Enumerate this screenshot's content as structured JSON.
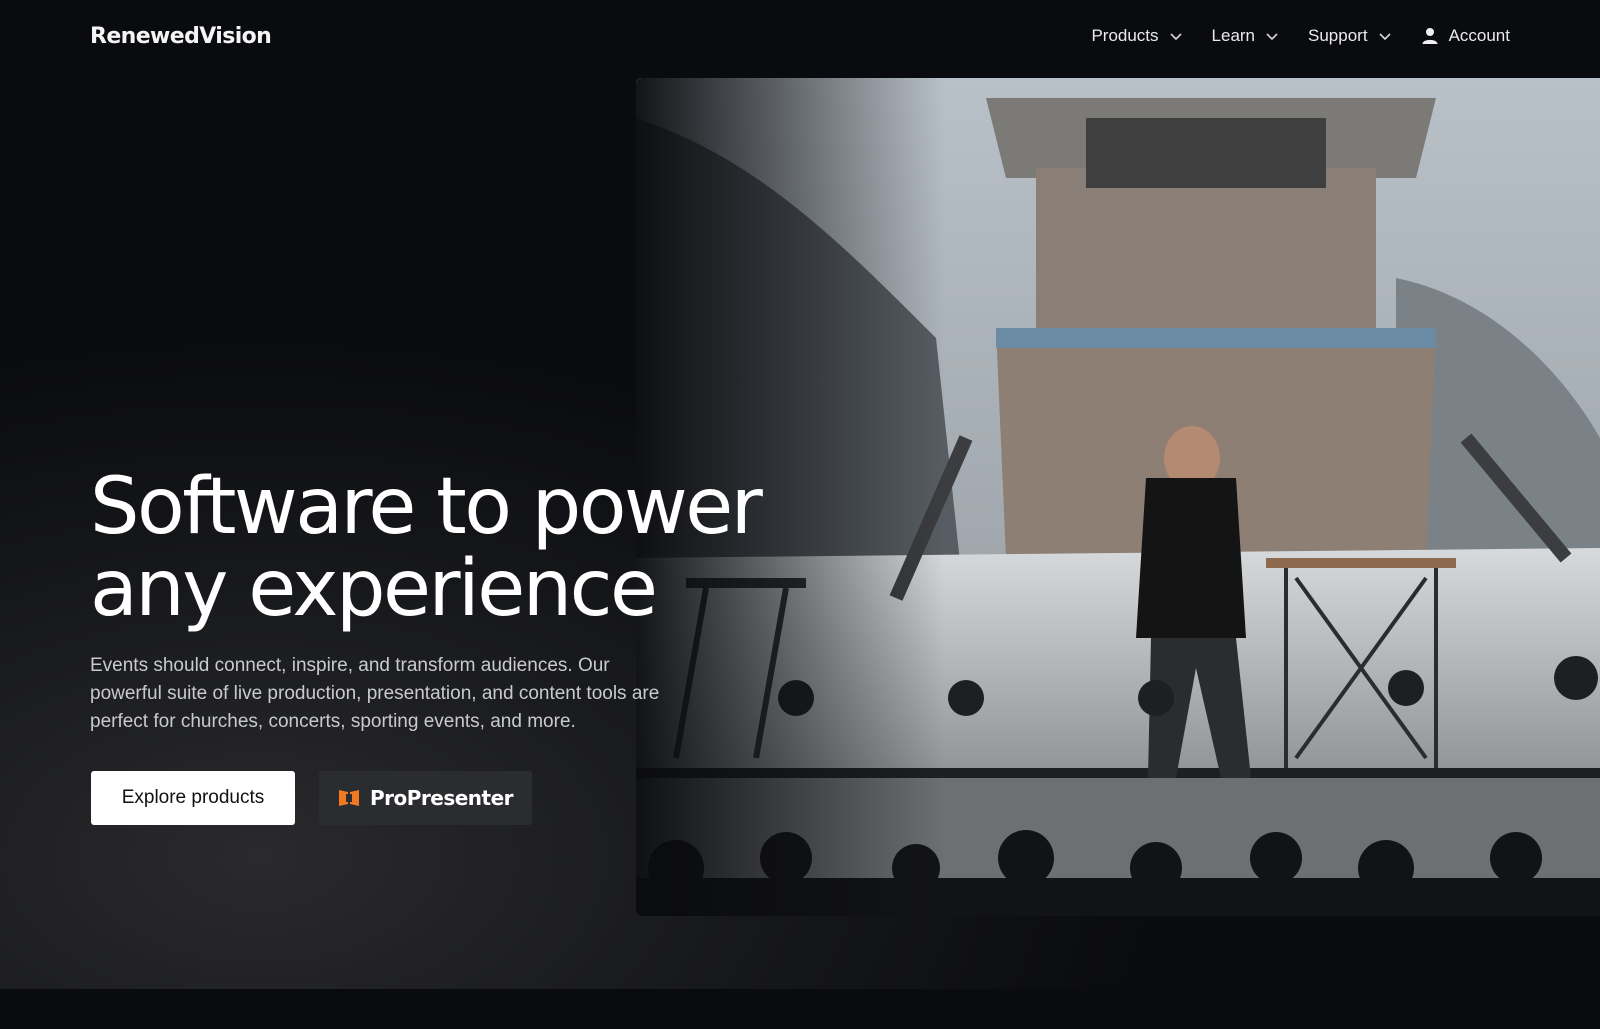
{
  "nav": {
    "logo": "RenewedVision",
    "items": [
      {
        "label": "Products",
        "icon": "chevron-down-icon"
      },
      {
        "label": "Learn",
        "icon": "chevron-down-icon"
      },
      {
        "label": "Support",
        "icon": "chevron-down-icon"
      }
    ],
    "account_label": "Account"
  },
  "hero": {
    "headline_line1": "Software to power",
    "headline_line2": "any experience",
    "subtext": "Events should connect, inspire, and transform audiences. Our powerful suite of live production, presentation, and content tools are perfect for churches, concerts, sporting events, and more.",
    "primary_button": "Explore products",
    "secondary_button": "ProPresenter"
  },
  "colors": {
    "background": "#0a0b0e",
    "primary_button_bg": "#ffffff",
    "secondary_button_bg": "#2b2c2f",
    "propresenter_accent": "#f07a22"
  }
}
